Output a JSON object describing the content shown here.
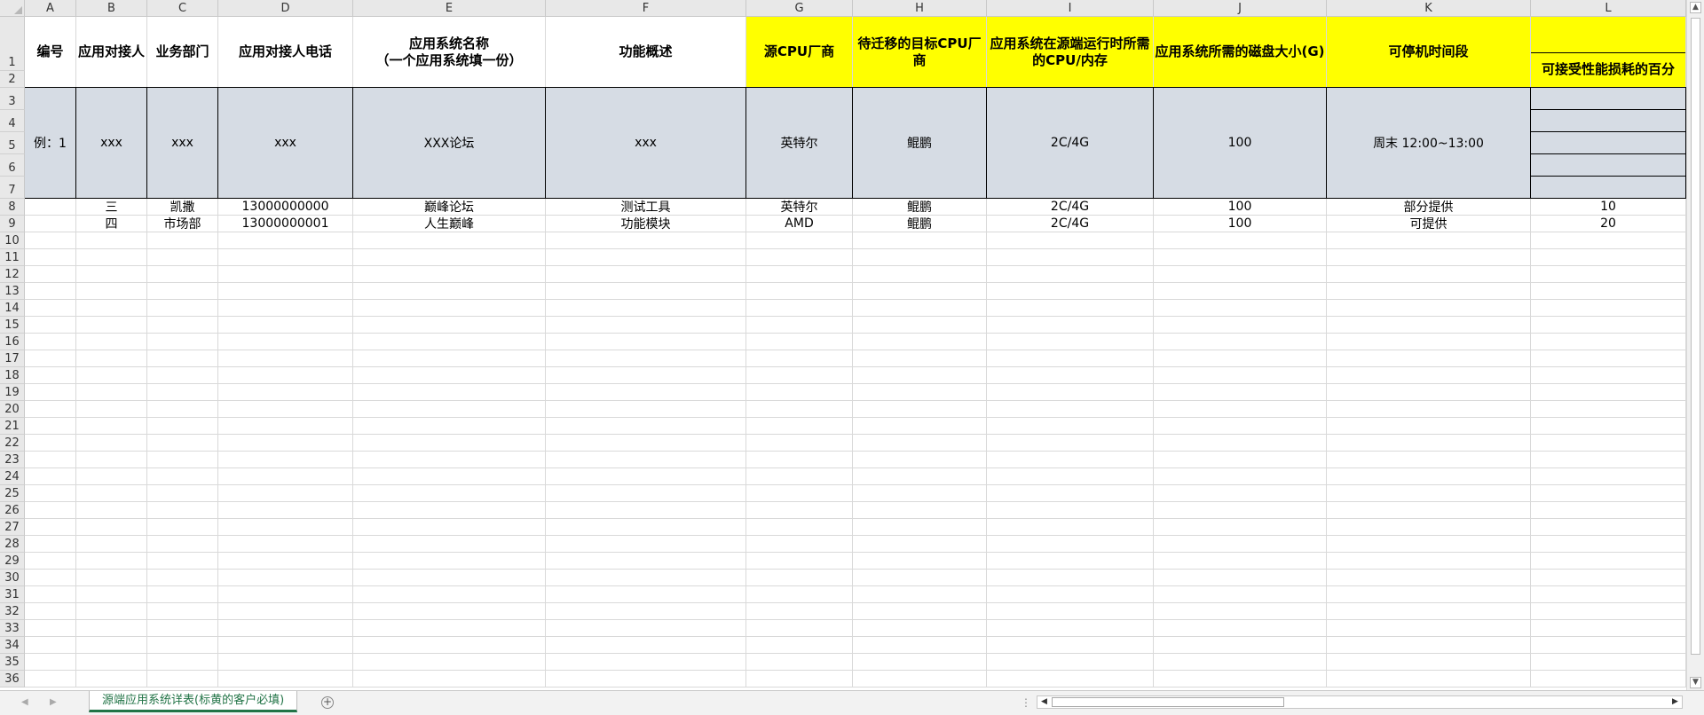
{
  "columns": [
    "A",
    "B",
    "C",
    "D",
    "E",
    "F",
    "G",
    "H",
    "I",
    "J",
    "K",
    "L"
  ],
  "rows": [
    "1",
    "2",
    "3",
    "4",
    "5",
    "6",
    "7",
    "8",
    "9",
    "10",
    "11",
    "12",
    "13",
    "14",
    "15",
    "16",
    "17",
    "18",
    "19",
    "20",
    "21",
    "22",
    "23",
    "24",
    "25",
    "26",
    "27",
    "28",
    "29",
    "30",
    "31",
    "32",
    "33",
    "34",
    "35",
    "36"
  ],
  "header": {
    "a": "编号",
    "b": "应用对接人",
    "c": "业务部门",
    "d": "应用对接人电话",
    "e": "应用系统名称\n（一个应用系统填一份）",
    "f": "功能概述",
    "g": "源CPU厂商",
    "h": "待迁移的目标CPU厂商",
    "i": "应用系统在源端运行时所需的CPU/内存",
    "j": "应用系统所需的磁盘大小(G)",
    "k": "可停机时间段",
    "l": "可接受性能损耗的百分"
  },
  "example": {
    "a": "例：1",
    "b": "xxx",
    "c": "xxx",
    "d": "xxx",
    "e": "XXX论坛",
    "f": "xxx",
    "g": "英特尔",
    "h": "鲲鹏",
    "i": "2C/4G",
    "j": "100",
    "k": "周末 12:00~13:00"
  },
  "data_rows": [
    {
      "a": "",
      "b": "三",
      "c": "凯撒",
      "d": "13000000000",
      "e": "巅峰论坛",
      "f": "测试工具",
      "g": "英特尔",
      "h": "鲲鹏",
      "i": "2C/4G",
      "j": "100",
      "k": "部分提供",
      "l": "10"
    },
    {
      "a": "",
      "b": "四",
      "c": "市场部",
      "d": "13000000001",
      "e": "人生巅峰",
      "f": "功能模块",
      "g": "AMD",
      "h": "鲲鹏",
      "i": "2C/4G",
      "j": "100",
      "k": "可提供",
      "l": "20"
    }
  ],
  "sheet_tab": "源端应用系统详表(标黄的客户必填)",
  "colors": {
    "highlight": "#ffff00",
    "example_fill": "#d6dce4",
    "tab_accent": "#217346"
  },
  "icons": [
    "add-sheet-icon",
    "scroll-left-icon",
    "scroll-right-icon",
    "scroll-up-icon",
    "scroll-down-icon"
  ]
}
